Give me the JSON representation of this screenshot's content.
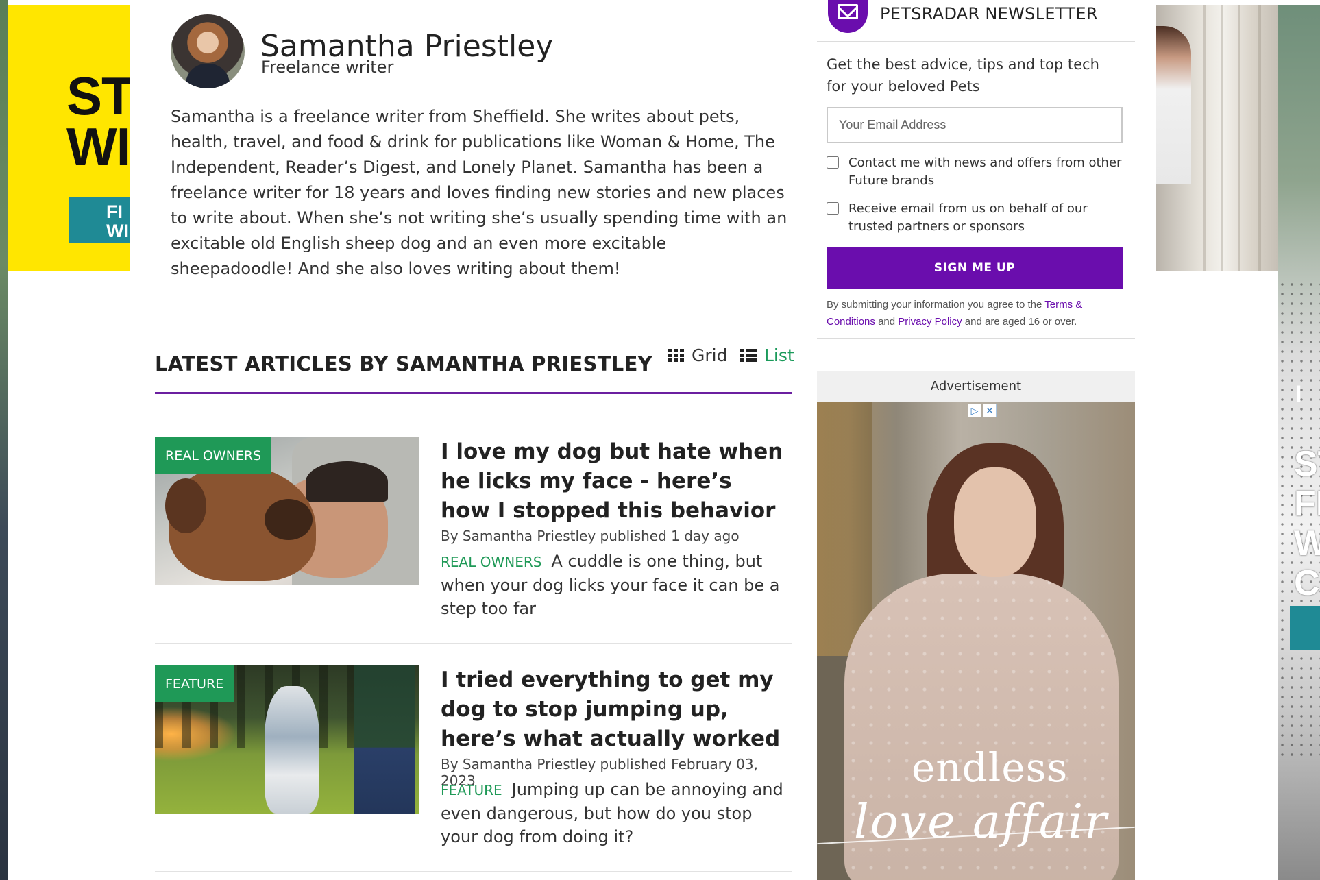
{
  "author": {
    "name": "Samantha Priestley",
    "role": "Freelance writer",
    "bio": "Samantha is a freelance writer from Sheffield. She writes about pets, health, travel, and food & drink for publications like Woman & Home, The Independent, Reader’s Digest, and Lonely Planet. Samantha has been a freelance writer for 18 years and loves finding new stories and new places to write about. When she’s not writing she’s usually spending time with an excitable old English sheep dog and an even more excitable sheepadoodle! And she also loves writing about them!"
  },
  "articles_section": {
    "title": "LATEST ARTICLES BY SAMANTHA PRIESTLEY",
    "view_grid": "Grid",
    "view_list": "List",
    "active_view": "List"
  },
  "articles": [
    {
      "tag": "REAL OWNERS",
      "title": "I love my dog but hate when he licks my face - here’s how I stopped this behavior",
      "byline": "By Samantha Priestley published 1 day ago",
      "category": "REAL OWNERS",
      "excerpt": "A cuddle is one thing, but when your dog licks your face it can be a step too far"
    },
    {
      "tag": "FEATURE",
      "title": "I tried everything to get my dog to stop jumping up, here’s what actually worked",
      "byline": "By Samantha Priestley published February 03, 2023",
      "category": "FEATURE",
      "excerpt": "Jumping up can be annoying and even dangerous, but how do you stop your dog from doing it?"
    }
  ],
  "newsletter": {
    "icon": "envelope-icon",
    "title": "PETSRADAR NEWSLETTER",
    "description": "Get the best advice, tips and top tech for your beloved Pets",
    "email_placeholder": "Your Email Address",
    "checkbox_1": "Contact me with news and offers from other Future brands",
    "checkbox_2": "Receive email from us on behalf of our trusted partners or sponsors",
    "button": "SIGN ME UP",
    "legal_prefix": "By submitting your information you agree to the",
    "legal_terms": "Terms & Conditions",
    "legal_and": "and",
    "legal_privacy": "Privacy Policy",
    "legal_suffix": "and are aged 16 or over."
  },
  "advertisement": {
    "label": "Advertisement",
    "text_line_1": "endless",
    "text_line_2": "love affair",
    "choices_icon": "ad-choices-icon",
    "close_icon": "close-icon"
  },
  "skin_ads": {
    "left_headline": "STI\nWI",
    "left_button": "FI\nWIN",
    "right_headline": "ST\nFI\nW\nCI",
    "right_top": "I"
  },
  "colors": {
    "brand_purple": "#6a0dad",
    "tag_green": "#1f9957",
    "list_active": "#1a9a5a"
  }
}
